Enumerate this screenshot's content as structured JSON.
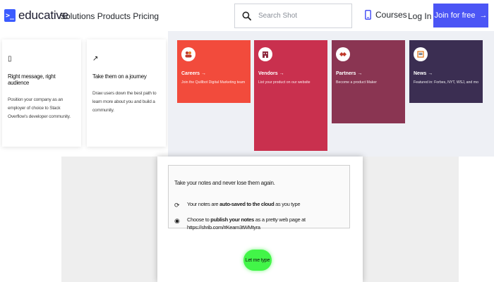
{
  "header": {
    "logo_mark": ">_",
    "logo_text": "educative",
    "nav_links": "Solutions Products Pricing",
    "search_placeholder": "Search Shot",
    "courses": "Courses",
    "login": "Log In",
    "join": "Join for free",
    "join_arrow": "→"
  },
  "info_cards": [
    {
      "icon": "▯",
      "title": "Right message, right audience",
      "body": "Position your company as an employer of choice to Stack Overflow's developer community."
    },
    {
      "icon": "↗",
      "title": "Take them on a journey",
      "body": "Draw users down the best path to learn more about you and build a community."
    }
  ],
  "color_cards": [
    {
      "title": "Careers →",
      "sub": "Join the Quillbot Digital Marketing team in Austin",
      "color": "#f24b3c",
      "icon": "people-icon"
    },
    {
      "title": "Vendors →",
      "sub": "List your product on our website",
      "color": "#c9304e",
      "icon": "building-icon"
    },
    {
      "title": "Partners →",
      "sub": "Become a product Maker",
      "color": "#8a3552",
      "icon": "handshake-icon"
    },
    {
      "title": "News →",
      "sub": "Featured in: Forbes, NYT, WSJ, and more",
      "color": "#3b2e52",
      "icon": "newspaper-icon"
    }
  ],
  "notes": {
    "title": "Take your notes and never lose them again.",
    "bullet1_pre": "Your notes are ",
    "bullet1_bold": "auto-saved to the cloud",
    "bullet1_post": " as you type",
    "bullet2_pre": "Choose to ",
    "bullet2_bold": "publish your notes",
    "bullet2_post": " as a pretty web page at",
    "bullet2_url": "https://shrib.com/#Kearn3tWMtyra",
    "button": "Let me type"
  },
  "colors": {
    "accent": "#4b55f5",
    "type_button": "#42f548"
  }
}
